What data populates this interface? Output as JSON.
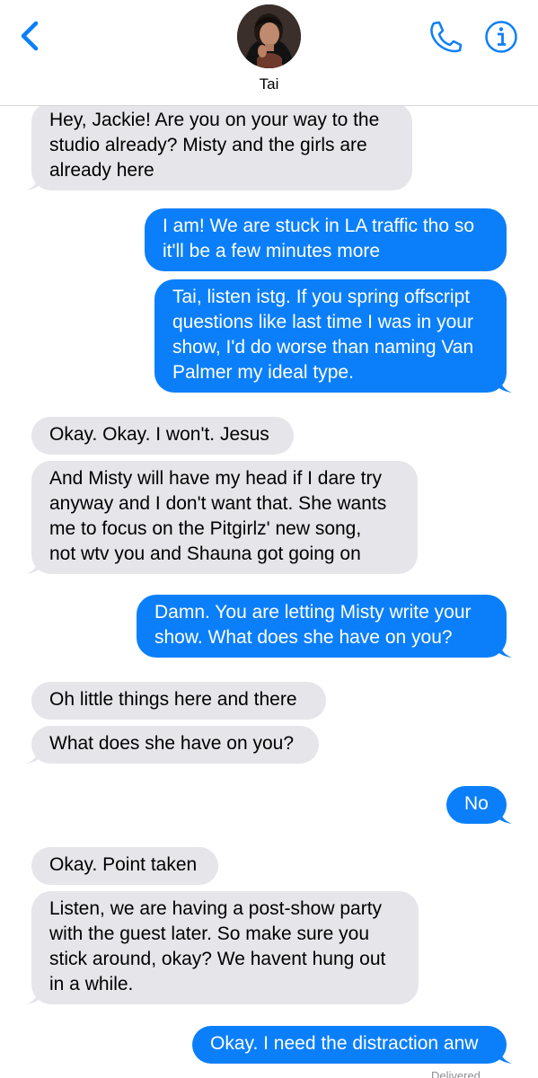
{
  "header": {
    "contact_name": "Tai",
    "back_icon": "chevron-left-icon",
    "call_icon": "phone-icon",
    "info_icon": "info-icon",
    "accent_color": "#0b7ff9"
  },
  "messages": [
    {
      "direction": "incoming",
      "lines": [
        "Hey, Jackie! Are you on your way to the",
        "studio already? Misty and the girls are",
        "already here"
      ]
    },
    {
      "direction": "outgoing",
      "lines": [
        "I am! We are stuck in LA traffic tho so",
        "it'll be a few minutes more"
      ]
    },
    {
      "direction": "outgoing",
      "lines": [
        "Tai, listen istg. If you spring offscript",
        "questions like last time I was in your",
        "show, I'd do worse than naming Van",
        "Palmer my ideal type."
      ]
    },
    {
      "direction": "incoming",
      "lines": [
        "Okay. Okay. I won't. Jesus"
      ]
    },
    {
      "direction": "incoming",
      "lines": [
        "And Misty will have my head if I dare try",
        "anyway and I don't want that. She wants",
        "me to focus on the Pitgirlz' new song,",
        "not wtv you and Shauna got going on"
      ]
    },
    {
      "direction": "outgoing",
      "lines": [
        "Damn. You are letting Misty write your",
        "show. What does she have on you?"
      ]
    },
    {
      "direction": "incoming",
      "lines": [
        "Oh little things here and there"
      ]
    },
    {
      "direction": "incoming",
      "lines": [
        "What does she have on you?"
      ]
    },
    {
      "direction": "outgoing",
      "lines": [
        "No"
      ]
    },
    {
      "direction": "incoming",
      "lines": [
        "Okay. Point taken"
      ]
    },
    {
      "direction": "incoming",
      "lines": [
        "Listen, we are having a post-show party",
        "with the guest later. So make sure you",
        "stick around, okay? We havent hung out",
        "in a while."
      ]
    },
    {
      "direction": "outgoing",
      "lines": [
        "Okay. I need the distraction anw"
      ]
    }
  ],
  "status": {
    "delivered": "Delivered"
  },
  "colors": {
    "incoming_bubble": "#e5e5ea",
    "outgoing_bubble": "#0b7ff9"
  }
}
